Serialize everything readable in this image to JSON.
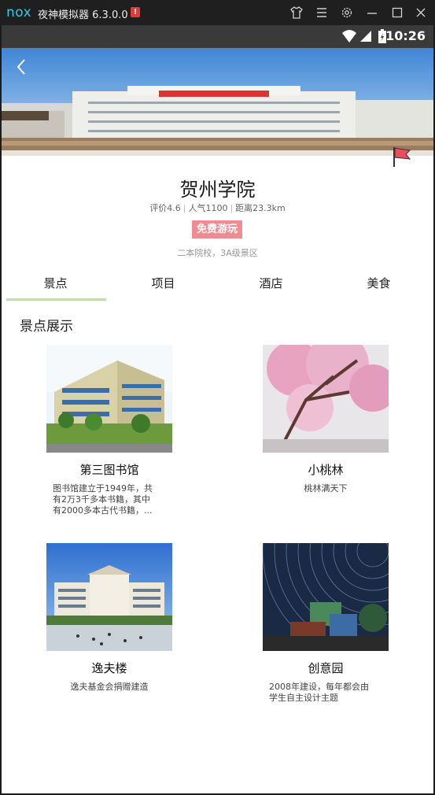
{
  "window": {
    "logo": "nox",
    "title": "夜神模拟器 6.3.0.0",
    "warning_badge": "!",
    "icons": [
      "shirt-icon",
      "menu-icon",
      "gear-icon",
      "minimize-icon",
      "maximize-icon",
      "close-icon"
    ]
  },
  "statusbar": {
    "time": "10:26"
  },
  "place": {
    "name": "贺州学院",
    "stats": {
      "rating": "评价4.6",
      "popularity": "人气1100",
      "distance": "距离23.3km"
    },
    "tag": "免费游玩",
    "subtitle": "二本院校，3A级景区"
  },
  "tabs": [
    {
      "label": "景点",
      "active": true
    },
    {
      "label": "项目",
      "active": false
    },
    {
      "label": "酒店",
      "active": false
    },
    {
      "label": "美食",
      "active": false
    }
  ],
  "section": {
    "title": "景点展示"
  },
  "spots": [
    {
      "name": "第三图书馆",
      "desc": "图书馆建立于1949年，共有2万3千多本书籍，其中有2000多本古代书籍，..."
    },
    {
      "name": "小桃林",
      "desc": "桃林满天下"
    },
    {
      "name": "逸夫楼",
      "desc": "逸夫基金会捐赠建造"
    },
    {
      "name": "创意园",
      "desc": "2008年建设，每年都会由学生自主设计主题"
    }
  ],
  "colors": {
    "tab_underline": "#b9e986",
    "tag_bg": "#f08a93",
    "accent": "#35c9ea"
  }
}
